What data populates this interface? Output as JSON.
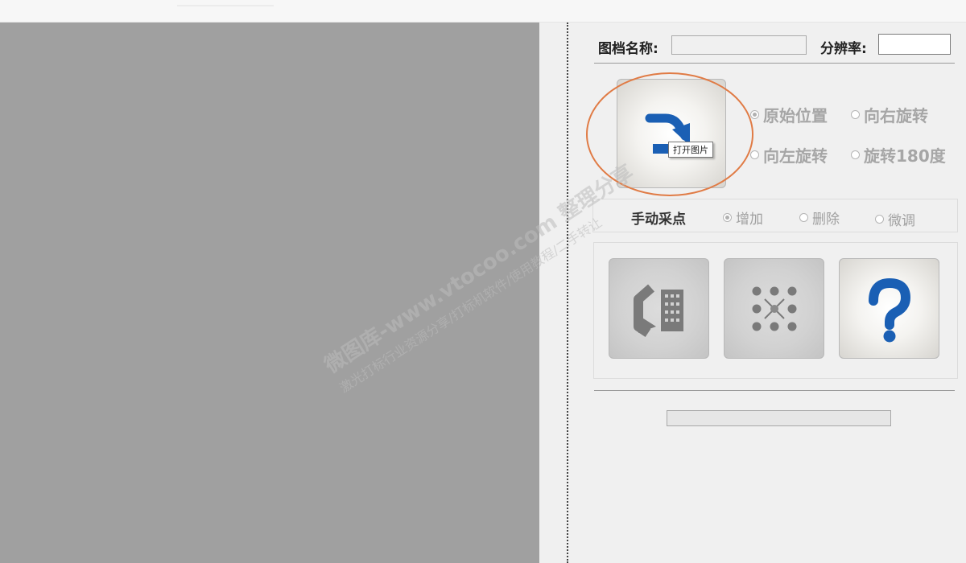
{
  "header": {
    "file_name_label": "图档名称:",
    "file_name_value": "",
    "resolution_label": "分辨率:",
    "resolution_value": ""
  },
  "open_image": {
    "icon": "open-image-arrow-icon",
    "tooltip": "打开图片"
  },
  "rotation": {
    "options": [
      "原始位置",
      "向右旋转",
      "向左旋转",
      "旋转180度"
    ],
    "selected": "原始位置"
  },
  "manual_points": {
    "label": "手动采点",
    "options": [
      "增加",
      "删除",
      "微调"
    ],
    "selected": "增加"
  },
  "action_buttons": [
    {
      "icon": "convert-to-grid-icon"
    },
    {
      "icon": "dot-grid-calibration-icon"
    },
    {
      "icon": "help-question-icon"
    }
  ],
  "progress": {
    "value": 0
  },
  "watermark": {
    "line1": "微图库-www.vtocoo.com 整理分享",
    "line2": "激光打标行业资源分享/打标机软件/使用教程/二手转让"
  },
  "colors": {
    "accent_blue": "#1a5fb4",
    "highlight_ring": "#e07b45",
    "canvas_grey": "#a0a0a0",
    "icon_grey": "#7a7a7a"
  }
}
